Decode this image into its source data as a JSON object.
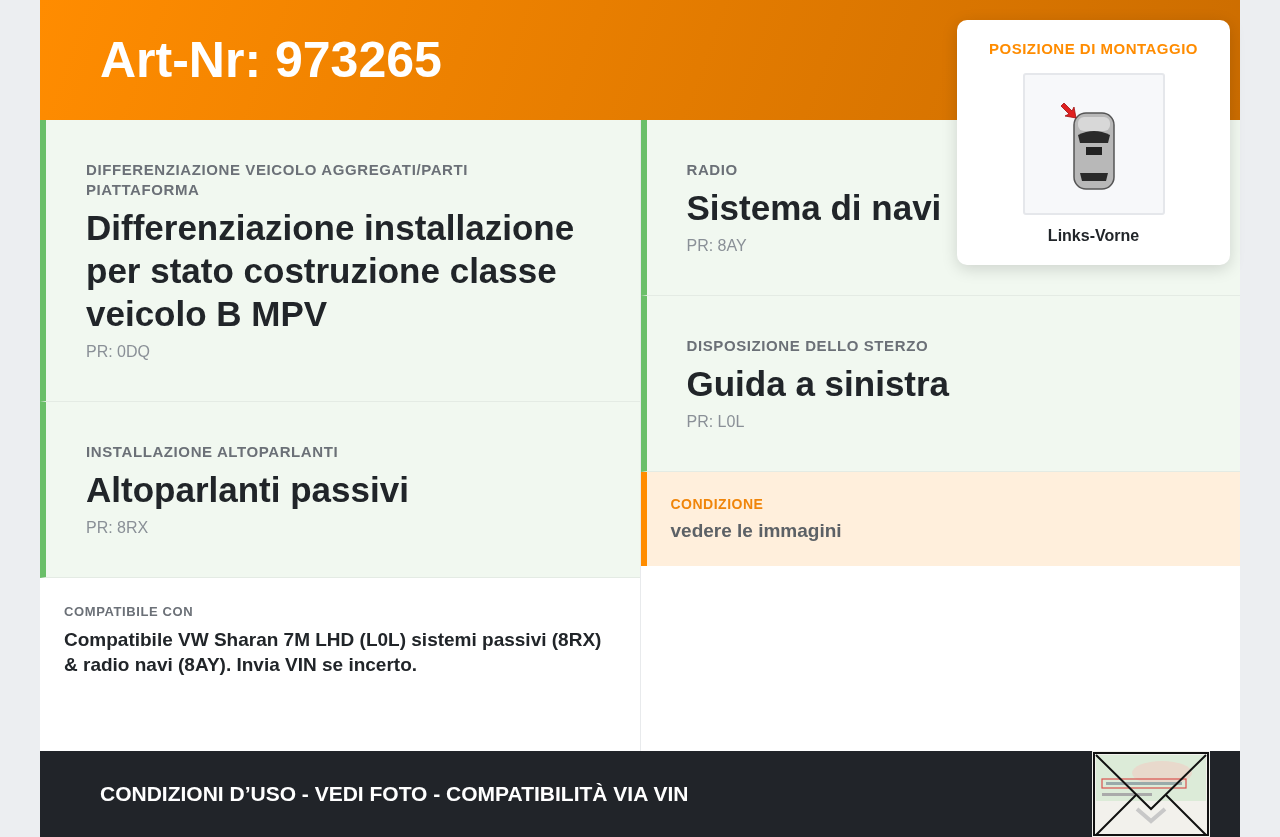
{
  "header": {
    "title": "Art-Nr: 973265"
  },
  "mount_position": {
    "title": "POSIZIONE DI MONTAGGIO",
    "caption": "Links-Vorne"
  },
  "left_column": [
    {
      "kind": "spec",
      "label": "DIFFERENZIAZIONE VEICOLO AGGREGATI/PARTI PIATTAFORMA",
      "value": "Differenziazione installazione per stato costruzione classe veicolo B MPV",
      "code": "PR: 0DQ"
    },
    {
      "kind": "spec",
      "label": "INSTALLAZIONE ALTOPARLANTI",
      "value": "Altoparlanti passivi",
      "code": "PR: 8RX"
    },
    {
      "kind": "note",
      "label": "COMPATIBILE CON",
      "value": "Compatibile VW Sharan 7M LHD (L0L) sistemi passivi (8RX) & radio navi (8AY). Invia VIN se incerto."
    }
  ],
  "right_column": [
    {
      "kind": "spec",
      "label": "RADIO",
      "value": "Sistema di navi",
      "code": "PR: 8AY"
    },
    {
      "kind": "spec",
      "label": "DISPOSIZIONE DELLO STERZO",
      "value": "Guida a sinistra",
      "code": "PR: L0L"
    },
    {
      "kind": "condition",
      "label": "CONDIZIONE",
      "value": "vedere le immagini"
    }
  ],
  "footer": {
    "text": "CONDIZIONI D’USO - VEDI FOTO - COMPATIBILITÀ VIA VIN"
  }
}
